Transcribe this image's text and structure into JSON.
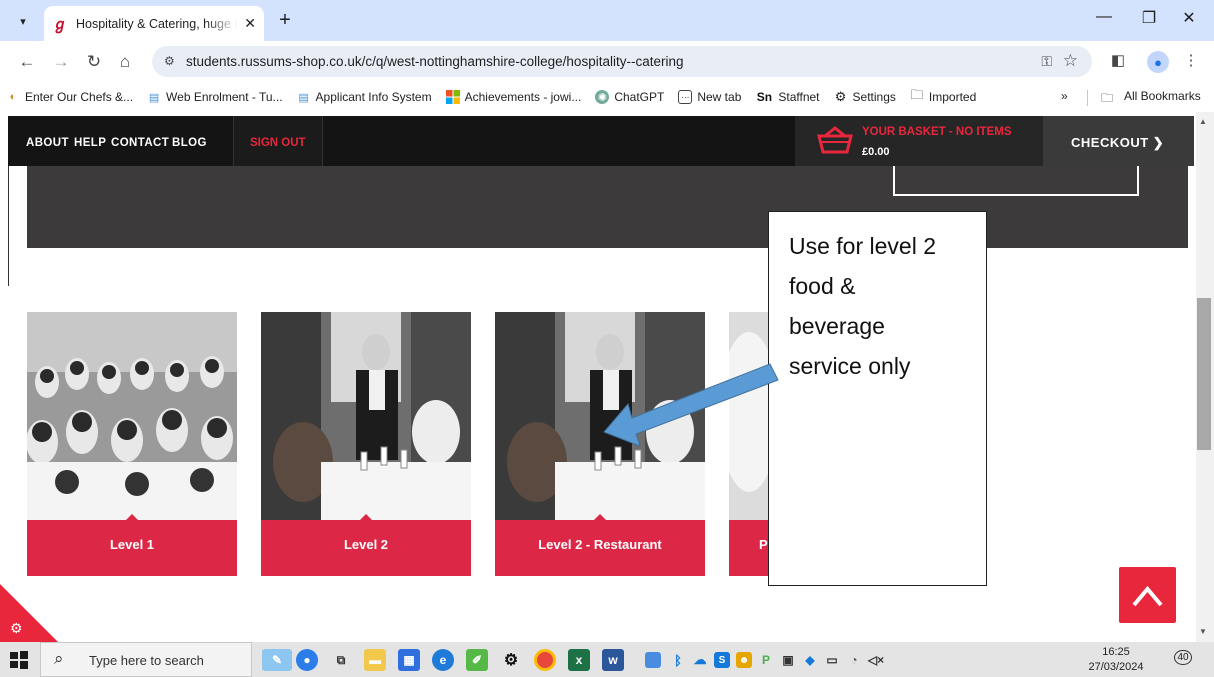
{
  "browser": {
    "tab_title": "Hospitality & Catering, huge ra",
    "url": "students.russums-shop.co.uk/c/q/west-nottinghamshire-college/hospitality--catering",
    "bookmarks": [
      "Enter Our Chefs &...",
      "Web Enrolment - Tu...",
      "Applicant Info System",
      "Achievements - jowi...",
      "ChatGPT",
      "New tab",
      "Staffnet",
      "Settings",
      "Imported"
    ],
    "bookmarks_more": "»",
    "all_bookmarks": "All Bookmarks"
  },
  "site": {
    "nav": [
      "ABOUT",
      "HELP",
      "CONTACT",
      "BLOG"
    ],
    "sign_out": "SIGN OUT",
    "basket_label": "YOUR BASKET - NO ITEMS",
    "basket_amount": "£0.00",
    "checkout": "CHECKOUT",
    "accent": "#e8263c"
  },
  "cards": [
    {
      "label": "Level 1"
    },
    {
      "label": "Level 2"
    },
    {
      "label": "Level 2 - Restaurant"
    },
    {
      "label": "P"
    }
  ],
  "callout": {
    "lines": [
      "Use for level 2",
      "food &",
      "beverage",
      "service only"
    ]
  },
  "taskbar": {
    "search_placeholder": "Type here to search",
    "time": "16:25",
    "date": "27/03/2024",
    "notifications": "40"
  }
}
